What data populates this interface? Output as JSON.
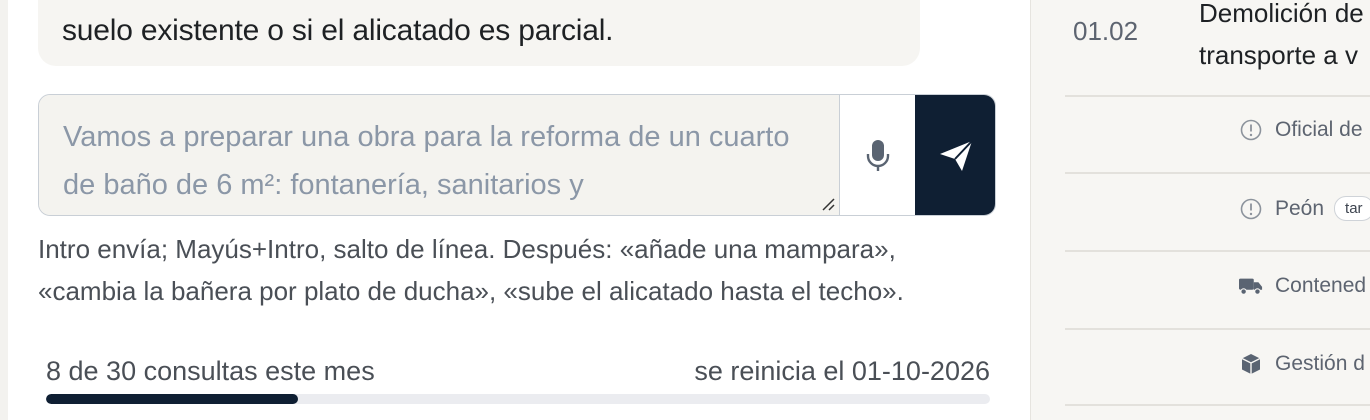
{
  "chat": {
    "last_message_tail": "suelo existente o si el alicatado es parcial.",
    "composer": {
      "placeholder": "Vamos a preparar una obra para la reforma de un cuarto de baño de 6 m²: fontanería, sanitarios y"
    },
    "hint": "Intro envía; Mayús+Intro, salto de línea. Después: «añade una mampara», «cambia la bañera por plato de ducha», «sube el alicatado hasta el techo».",
    "usage": {
      "count_label": "8 de 30 consultas este mes",
      "reset_label": "se reinicia el 01-10-2026",
      "used": 8,
      "limit": 30
    }
  },
  "side_panel": {
    "item_code": "01.02",
    "item_title_line1": "Demolición de",
    "item_title_line2": "transporte a v",
    "resources": [
      {
        "icon": "alert-circle-icon",
        "label": "Oficial de",
        "tag": ""
      },
      {
        "icon": "alert-circle-icon",
        "label": "Peón",
        "tag": "tar"
      },
      {
        "icon": "truck-icon",
        "label": "Contened",
        "tag": ""
      },
      {
        "icon": "box-icon",
        "label": "Gestión d",
        "tag": ""
      }
    ]
  },
  "colors": {
    "accent_dark": "#0f1f33",
    "placeholder": "#8b97a7",
    "panel_bg": "#f7f6f3"
  }
}
